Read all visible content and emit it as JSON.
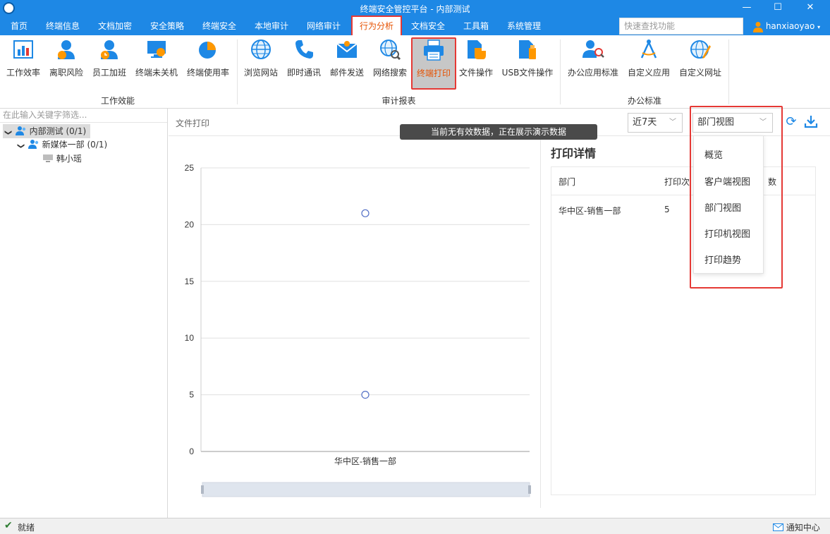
{
  "window": {
    "title": "终端安全管控平台 - 内部测试"
  },
  "menu": [
    "首页",
    "终端信息",
    "文档加密",
    "安全策略",
    "终端安全",
    "本地审计",
    "网络审计",
    "行为分析",
    "文档安全",
    "工具箱",
    "系统管理"
  ],
  "menu_active": "行为分析",
  "search": {
    "placeholder": "快速查找功能"
  },
  "user": {
    "name": "hanxiaoyao"
  },
  "ribbon": {
    "groups": [
      {
        "label": "工作效能",
        "items": [
          "工作效率",
          "离职风险",
          "员工加班",
          "终端未关机",
          "终端使用率"
        ]
      },
      {
        "label": "审计报表",
        "items": [
          "浏览网站",
          "即时通讯",
          "邮件发送",
          "网络搜索",
          "终端打印",
          "文件操作",
          "USB文件操作"
        ]
      },
      {
        "label": "办公标准",
        "items": [
          "办公应用标准",
          "自定义应用",
          "自定义网址"
        ]
      }
    ],
    "selected": "终端打印"
  },
  "tree": {
    "filter_placeholder": "在此输入关键字筛选...",
    "nodes": [
      {
        "label": "内部测试 (0/1)"
      },
      {
        "label": "新媒体一部 (0/1)"
      },
      {
        "label": "韩小瑶"
      }
    ]
  },
  "content": {
    "title": "文件打印",
    "toast": "当前无有效数据，正在展示演示数据",
    "range_select": "近7天",
    "view_select": "部门视图",
    "view_options": [
      "概览",
      "客户端视图",
      "部门视图",
      "打印机视图",
      "打印趋势"
    ]
  },
  "chart_data": {
    "type": "scatter",
    "categories": [
      "华中区-销售一部"
    ],
    "series": [
      {
        "values": [
          21
        ]
      },
      {
        "values": [
          5
        ]
      }
    ],
    "ylim": [
      0,
      25
    ],
    "yticks": [
      0,
      5,
      10,
      15,
      20,
      25
    ],
    "grid": true
  },
  "detail": {
    "title": "打印详情",
    "headers": [
      "部门",
      "打印次",
      "数"
    ],
    "rows": [
      [
        "华中区-销售一部",
        "5"
      ]
    ]
  },
  "status": {
    "ready": "就绪",
    "notify": "通知中心"
  },
  "colors": {
    "primary": "#1e88e5",
    "highlight": "#e53935",
    "active_text": "#e65100"
  }
}
